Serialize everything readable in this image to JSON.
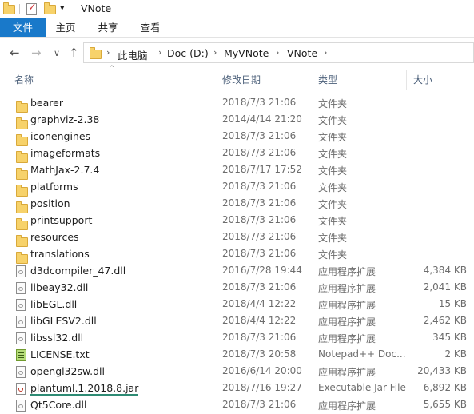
{
  "window": {
    "title": "VNote",
    "quick_access_dropdown": "▾"
  },
  "ribbon": {
    "tabs": [
      {
        "label": "文件",
        "active": true
      },
      {
        "label": "主页"
      },
      {
        "label": "共享"
      },
      {
        "label": "查看"
      }
    ]
  },
  "address": {
    "back": "←",
    "forward": "→",
    "recent": "∨",
    "up": "↑",
    "crumbs": [
      "此电脑",
      "Doc (D:)",
      "MyVNote",
      "VNote"
    ]
  },
  "columns": {
    "name": "名称",
    "date": "修改日期",
    "type": "类型",
    "size": "大小",
    "sort_indicator": "^"
  },
  "files": [
    {
      "name": "bearer",
      "date": "2018/7/3 21:06",
      "type": "文件夹",
      "size": "",
      "icon": "folder-icon"
    },
    {
      "name": "graphviz-2.38",
      "date": "2014/4/14 21:20",
      "type": "文件夹",
      "size": "",
      "icon": "folder-icon"
    },
    {
      "name": "iconengines",
      "date": "2018/7/3 21:06",
      "type": "文件夹",
      "size": "",
      "icon": "folder-icon"
    },
    {
      "name": "imageformats",
      "date": "2018/7/3 21:06",
      "type": "文件夹",
      "size": "",
      "icon": "folder-icon"
    },
    {
      "name": "MathJax-2.7.4",
      "date": "2018/7/17 17:52",
      "type": "文件夹",
      "size": "",
      "icon": "folder-icon"
    },
    {
      "name": "platforms",
      "date": "2018/7/3 21:06",
      "type": "文件夹",
      "size": "",
      "icon": "folder-icon"
    },
    {
      "name": "position",
      "date": "2018/7/3 21:06",
      "type": "文件夹",
      "size": "",
      "icon": "folder-icon"
    },
    {
      "name": "printsupport",
      "date": "2018/7/3 21:06",
      "type": "文件夹",
      "size": "",
      "icon": "folder-icon"
    },
    {
      "name": "resources",
      "date": "2018/7/3 21:06",
      "type": "文件夹",
      "size": "",
      "icon": "folder-icon"
    },
    {
      "name": "translations",
      "date": "2018/7/3 21:06",
      "type": "文件夹",
      "size": "",
      "icon": "folder-icon"
    },
    {
      "name": "d3dcompiler_47.dll",
      "date": "2016/7/28 19:44",
      "type": "应用程序扩展",
      "size": "4,384 KB",
      "icon": "dll-icon"
    },
    {
      "name": "libeay32.dll",
      "date": "2018/7/3 21:06",
      "type": "应用程序扩展",
      "size": "2,041 KB",
      "icon": "dll-icon"
    },
    {
      "name": "libEGL.dll",
      "date": "2018/4/4 12:22",
      "type": "应用程序扩展",
      "size": "15 KB",
      "icon": "dll-icon"
    },
    {
      "name": "libGLESV2.dll",
      "date": "2018/4/4 12:22",
      "type": "应用程序扩展",
      "size": "2,462 KB",
      "icon": "dll-icon"
    },
    {
      "name": "libssl32.dll",
      "date": "2018/7/3 21:06",
      "type": "应用程序扩展",
      "size": "345 KB",
      "icon": "dll-icon"
    },
    {
      "name": "LICENSE.txt",
      "date": "2018/7/3 20:58",
      "type": "Notepad++ Doc...",
      "size": "2 KB",
      "icon": "notepad-document-icon"
    },
    {
      "name": "opengl32sw.dll",
      "date": "2016/6/14 20:00",
      "type": "应用程序扩展",
      "size": "20,433 KB",
      "icon": "dll-icon"
    },
    {
      "name": "plantuml.1.2018.8.jar",
      "date": "2018/7/16 19:27",
      "type": "Executable Jar File",
      "size": "6,892 KB",
      "icon": "jar-file-icon",
      "highlighted": true
    },
    {
      "name": "Qt5Core.dll",
      "date": "2018/7/3 21:06",
      "type": "应用程序扩展",
      "size": "5,655 KB",
      "icon": "dll-icon"
    }
  ]
}
